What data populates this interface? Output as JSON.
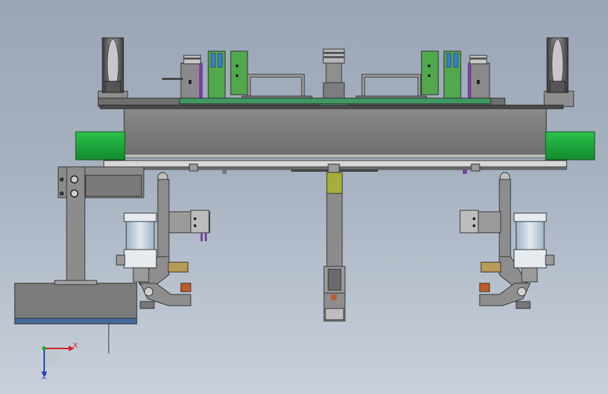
{
  "viewport": {
    "background_top": "#9aa6b6",
    "background_bottom": "#c9d0db"
  },
  "colors": {
    "frame_gray": "#7c7c7c",
    "frame_dark": "#545454",
    "accent_green": "#18a638",
    "block_green": "#52a84c",
    "cylinder_blue": "#c3d3e0",
    "cylinder_base": "#e6ebef",
    "purple": "#7a3e9d",
    "brass": "#b79a55",
    "orange": "#c25a25",
    "yellow_green": "#a6ad3a",
    "base_blue": "#466a9a"
  },
  "triad": {
    "x_label": "X",
    "z_label": "Z",
    "x_color": "#d42020",
    "y_color": "#20b020",
    "z_color": "#2040c0"
  }
}
